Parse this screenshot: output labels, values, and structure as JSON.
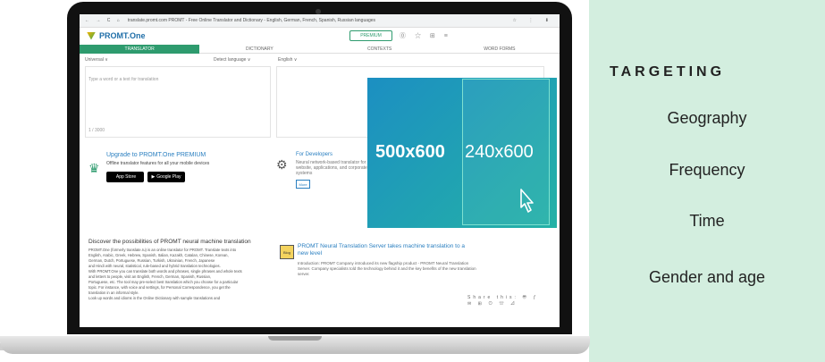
{
  "browser": {
    "nav_icons": "← → C ⌂",
    "url": "translate.promt.com  PROMT - Free Online Translator and Dictionary - English, German, French, Spanish, Russian languages",
    "right_icons": "☆ ⋮ ⬇"
  },
  "app": {
    "logo_text": "PROMT.One",
    "premium_label": "PREMIUM",
    "header_icons": "⓪ ☆ ⊞ ≡",
    "tabs": [
      "TRANSLATOR",
      "DICTIONARY",
      "CONTEXTS",
      "WORD FORMS"
    ],
    "source_lang": "Universal ∨",
    "detect_lang": "Detect language ∨",
    "target_lang": "English ∨",
    "source_placeholder": "Type a word or a text for translation",
    "source_counter": "1 / 3000",
    "upgrade_title": "Upgrade to PROMT.One PREMIUM",
    "upgrade_sub": "Offline translator features for all your mobile devices",
    "app_store": "App Store",
    "google_play": "Google Play",
    "devs_title": "For Developers",
    "devs_sub": "Neural network-based translator for website, applications, and corporate systems",
    "devs_more": "More",
    "discover_title": "Discover the possibilities of PROMT neural machine translation",
    "discover_lines": [
      "PROMT.One (formerly translate.ru) is an online translator for PROMT. Translate texts into",
      "English, Arabic, Greek, Hebrew, Spanish, Italian, Kazakh, Catalan, Chinese, Korean,",
      "German, Dutch, Portuguese, Russian, Turkish, Ukrainian, French, Japanese",
      "and Hindi with neural, statistical, rule-based and hybrid translation technologies.",
      "With PROMT.One you can translate both words and phrases, single phrases and whole texts",
      "and letters to people, visit an English, French, German, Spanish, Russian,",
      "Portuguese, etc. The tool may pre-select best translation which you choose for a particular",
      "topic. For instance, with voice and settings, for Personal Correspondence, you get the",
      "translation in an informal style.",
      "Look up words and idioms in the Online Dictionary with sample translations and"
    ],
    "nts_blog": "Blog",
    "nts_title": "PROMT Neural Translation Server takes machine translation to a new level",
    "nts_sub": "Introduction: PROMT Company introduced its new flagship product - PROMT Neural Translation Server. Company specialists told the technology behind it and the key benefits of the new translation server.",
    "share_label": "Share this:"
  },
  "ad": {
    "big_label": "500x600",
    "small_label": "240x600",
    "cursor_icon": "pointer-cursor-icon"
  },
  "targeting": {
    "title": "TARGETING",
    "items": [
      "Geography",
      "Frequency",
      "Time",
      "Gender and age"
    ]
  },
  "colors": {
    "panel": "#d3eedf",
    "accent": "#2e9b6e",
    "ad_start": "#1c8fc2",
    "ad_end": "#24b2a6"
  }
}
